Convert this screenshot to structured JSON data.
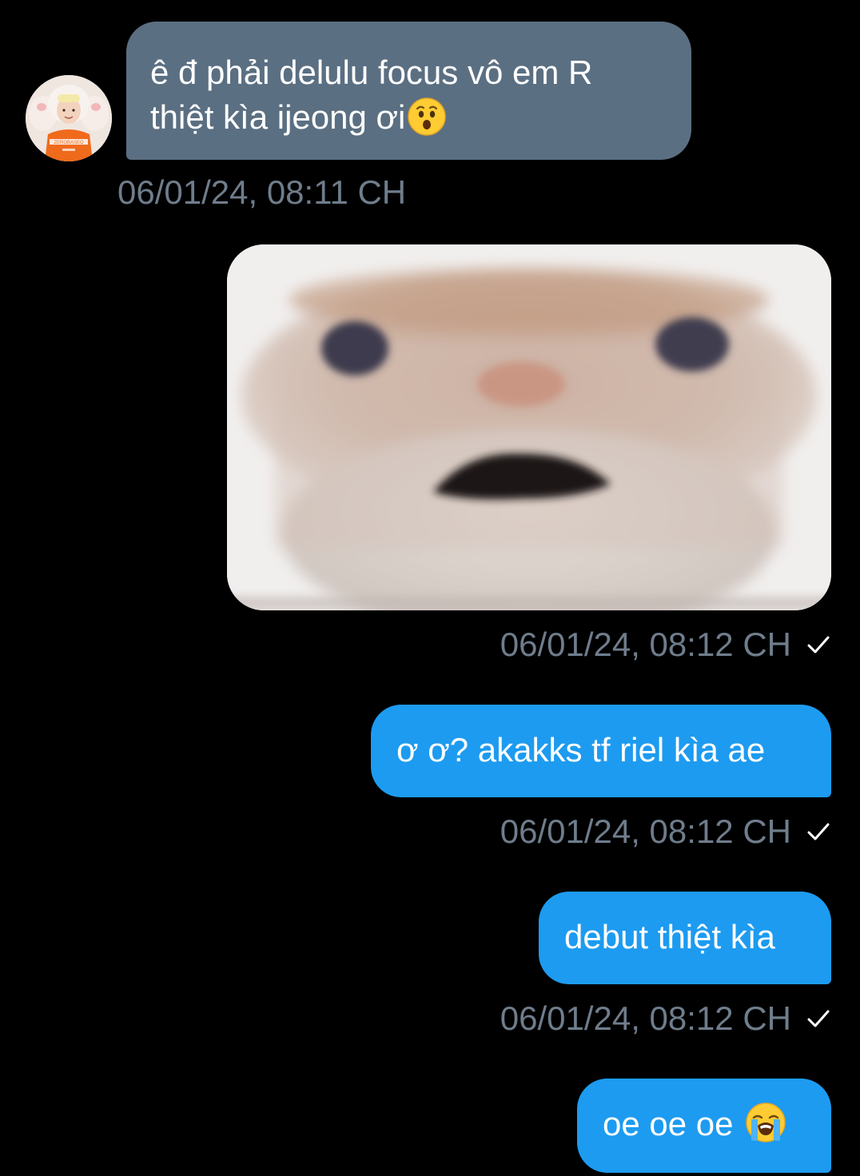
{
  "messages": {
    "incoming": {
      "line1": "ê đ phải delulu focus vô em R",
      "line2": "thiệt kìa ijeong ơi",
      "emoji": "hushed-face-emoji",
      "timestamp": "06/01/24, 08:11 CH"
    },
    "image": {
      "description_icon": "shocked-cat-photo",
      "timestamp": "06/01/24, 08:12 CH"
    },
    "outgoing": [
      {
        "text": "ơ ơ? akakks tf riel kìa ae",
        "timestamp": "06/01/24, 08:12 CH"
      },
      {
        "text": "debut thiệt kìa",
        "timestamp": "06/01/24, 08:12 CH"
      },
      {
        "text": "oe oe oe",
        "emoji": "loudly-crying-face-emoji"
      }
    ]
  },
  "colors": {
    "background": "#000000",
    "incoming_bubble": "#5b6f82",
    "outgoing_bubble": "#1d9bf0",
    "timestamp": "#6f7d8c"
  }
}
